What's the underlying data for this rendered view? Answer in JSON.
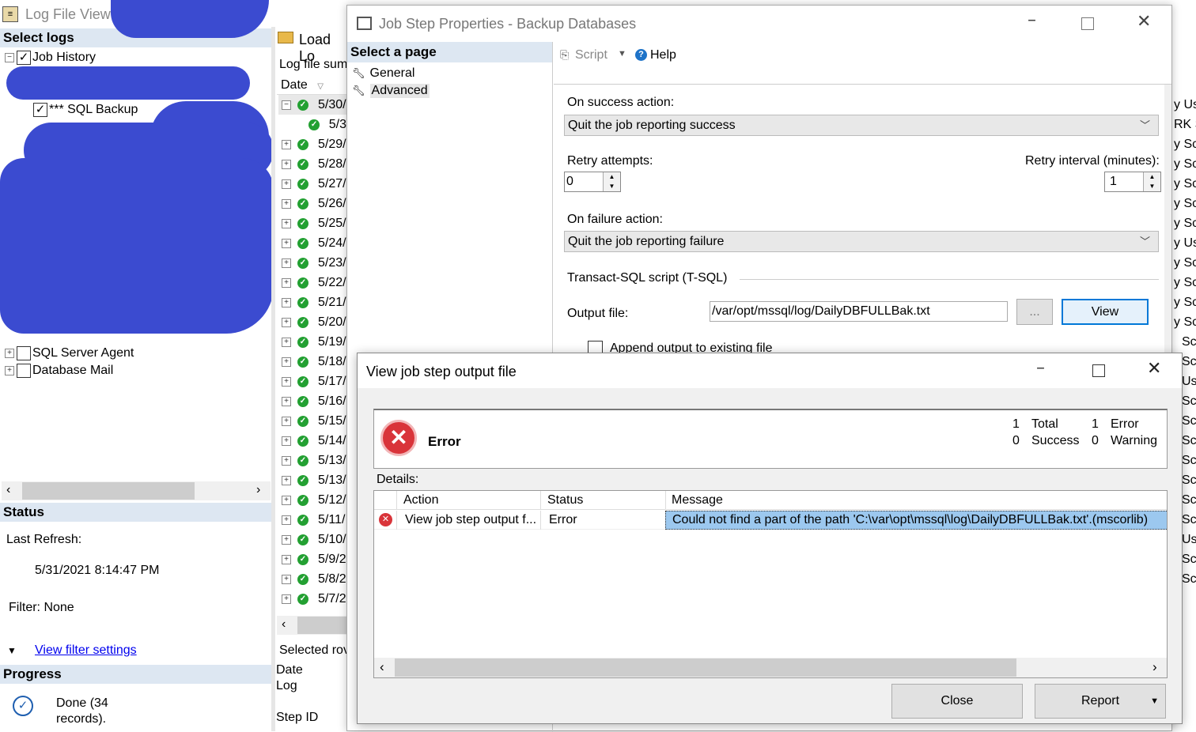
{
  "logviewer": {
    "title": "Log File Viewe",
    "select_logs": "Select logs",
    "job_history": "Job History",
    "sql_backup": "*** SQL Backup",
    "sql_agent": "SQL Server Agent",
    "db_mail": "Database Mail",
    "load_log": "Load Lo",
    "log_summary": "Log file sum",
    "date_col": "Date",
    "status_head": "Status",
    "last_refresh_label": "Last Refresh:",
    "last_refresh_value": "5/31/2021 8:14:47 PM",
    "filter": "Filter: None",
    "view_filter": "View filter settings",
    "progress_head": "Progress",
    "progress_text": "Done (34 records).",
    "selected_row": "Selected rov",
    "detail_date": "Date",
    "detail_log": "Log",
    "detail_step": "Step ID",
    "dates": [
      "5/30/",
      "5/3",
      "5/29/",
      "5/28/",
      "5/27/",
      "5/26/",
      "5/25/",
      "5/24/",
      "5/23/",
      "5/22/",
      "5/21/",
      "5/20/",
      "5/19/",
      "5/18/",
      "5/17/",
      "5/16/",
      "5/15/",
      "5/14/",
      "5/13/",
      "5/13/",
      "5/12/",
      "5/11/",
      "5/10/",
      "5/9/2",
      "5/8/2",
      "5/7/2"
    ],
    "right_col": [
      "y Us",
      "RK S",
      "y Sc",
      "y Sc",
      "y Sc",
      "y Sc",
      "y Sc",
      "y Us",
      "y Sc",
      "y Sc",
      "y Sc",
      "y Sc",
      "Sc",
      "Sc",
      "Us",
      "Sc",
      "Sc",
      "Sc",
      "Sc",
      "Sc",
      "Sc",
      "Sc",
      "Us",
      "Sc",
      "Sc"
    ]
  },
  "jobstep": {
    "title": "Job Step Properties - Backup Databases",
    "select_page": "Select a page",
    "pages": [
      "General",
      "Advanced"
    ],
    "script": "Script",
    "help": "Help",
    "on_success_label": "On success action:",
    "on_success_value": "Quit the job reporting success",
    "retry_attempts_label": "Retry attempts:",
    "retry_attempts_value": "0",
    "retry_interval_label": "Retry interval (minutes):",
    "retry_interval_value": "1",
    "on_failure_label": "On failure action:",
    "on_failure_value": "Quit the job reporting failure",
    "tsql_label": "Transact-SQL script (T-SQL)",
    "output_file_label": "Output file:",
    "output_file_value": "/var/opt/mssql/log/DailyDBFULLBak.txt",
    "browse": "...",
    "view": "View",
    "append": "Append output to existing file"
  },
  "output_dialog": {
    "title": "View job step output file",
    "error_heading": "Error",
    "total_count": "1",
    "total_label": "Total",
    "error_count": "1",
    "error_label": "Error",
    "success_count": "0",
    "success_label": "Success",
    "warning_count": "0",
    "warning_label": "Warning",
    "details_label": "Details:",
    "columns": [
      "Action",
      "Status",
      "Message"
    ],
    "row": {
      "action": "View job step output f...",
      "status": "Error",
      "message": "Could not find a part of the path 'C:\\var\\opt\\mssql\\log\\DailyDBFULLBak.txt'.(mscorlib)"
    },
    "close": "Close",
    "report": "Report"
  },
  "colors": {
    "accent": "#0078d7",
    "scribble": "#3b4bd0",
    "ok_green": "#23a032",
    "error_red": "#d9343a"
  }
}
